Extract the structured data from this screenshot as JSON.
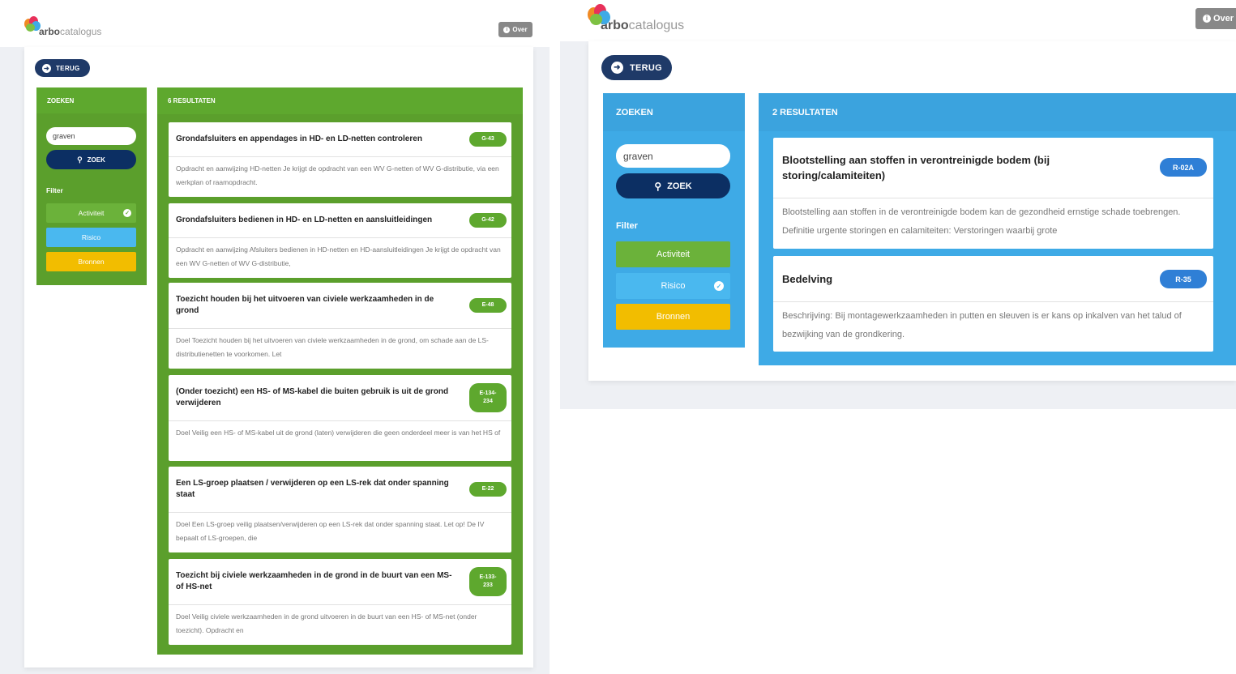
{
  "colors": {
    "green_panel": "#5b9f2c",
    "blue_panel": "#3eaae6",
    "navy": "#0c2f63",
    "activiteit": "#6bb23a",
    "risico": "#4ab8ef",
    "bronnen": "#f2bd00"
  },
  "brand": {
    "bold": "arbo",
    "rest": "catalogus"
  },
  "header": {
    "over_label": "Over",
    "info_icon": "i"
  },
  "back": {
    "label": "TERUG",
    "icon": "arrow-left-icon"
  },
  "left_view": {
    "zoeken_title": "ZOEKEN",
    "search_value": "graven",
    "zoek_label": "ZOEK",
    "filter_title": "Filter",
    "filters": [
      {
        "label": "Activiteit",
        "checked": true
      },
      {
        "label": "Risico",
        "checked": false
      },
      {
        "label": "Bronnen",
        "checked": false
      }
    ],
    "results_title": "6 RESULTATEN",
    "results": [
      {
        "title": "Grondafsluiters en appendages in HD- en LD-netten controleren",
        "code": "G-43",
        "description": "Opdracht en aanwijzing HD-netten Je krijgt de opdracht van een WV G-netten of WV G-distributie, via een werkplan of raamopdracht."
      },
      {
        "title": "Grondafsluiters bedienen in HD- en LD-netten en aansluitleidingen",
        "code": "G-42",
        "description": "Opdracht en aanwijzing Afsluiters bedienen in HD-netten en HD-aansluitleidingen Je krijgt de opdracht van een WV G-netten of WV G-distributie,"
      },
      {
        "title": "Toezicht houden bij het uitvoeren van civiele werkzaamheden in de grond",
        "code": "E-48",
        "description": "Doel Toezicht houden bij het uitvoeren van civiele werkzaamheden in de grond, om schade aan de LS-distributienetten te voorkomen. Let"
      },
      {
        "title": "(Onder toezicht) een HS- of MS-kabel die buiten gebruik is uit de grond verwijderen",
        "code": "E-134-234",
        "description": "Doel Veilig een HS- of MS-kabel uit de grond (laten) verwijderen die geen onderdeel meer is van het HS of"
      },
      {
        "title": "Een LS-groep plaatsen / verwijderen op een LS-rek dat onder spanning staat",
        "code": "E-22",
        "description": "Doel Een LS-groep veilig plaatsen/verwijderen op een LS-rek dat onder spanning staat. Let op! De IV bepaalt of LS-groepen, die"
      },
      {
        "title": "Toezicht bij civiele werkzaamheden in de grond in de buurt van een MS- of HS-net",
        "code": "E-133-233",
        "description": "Doel Veilig civiele werkzaamheden in de grond uitvoeren in de buurt van een HS- of MS-net (onder toezicht). Opdracht en"
      }
    ]
  },
  "right_view": {
    "zoeken_title": "ZOEKEN",
    "search_value": "graven",
    "zoek_label": "ZOEK",
    "filter_title": "Filter",
    "filters": [
      {
        "label": "Activiteit",
        "checked": false
      },
      {
        "label": "Risico",
        "checked": true
      },
      {
        "label": "Bronnen",
        "checked": false
      }
    ],
    "results_title": "2 RESULTATEN",
    "results": [
      {
        "title": "Blootstelling aan stoffen in verontreinigde bodem (bij storing/calamiteiten)",
        "code": "R-02A",
        "description": "Blootstelling aan stoffen in de verontreinigde bodem kan de gezondheid ernstige schade toebrengen. Definitie urgente storingen en calamiteiten: Verstoringen waarbij grote"
      },
      {
        "title": "Bedelving",
        "code": "R-35",
        "description": "Beschrijving: Bij montagewerkzaamheden in putten en sleuven is er kans op inkalven van het talud of bezwijking van de grondkering."
      }
    ]
  }
}
